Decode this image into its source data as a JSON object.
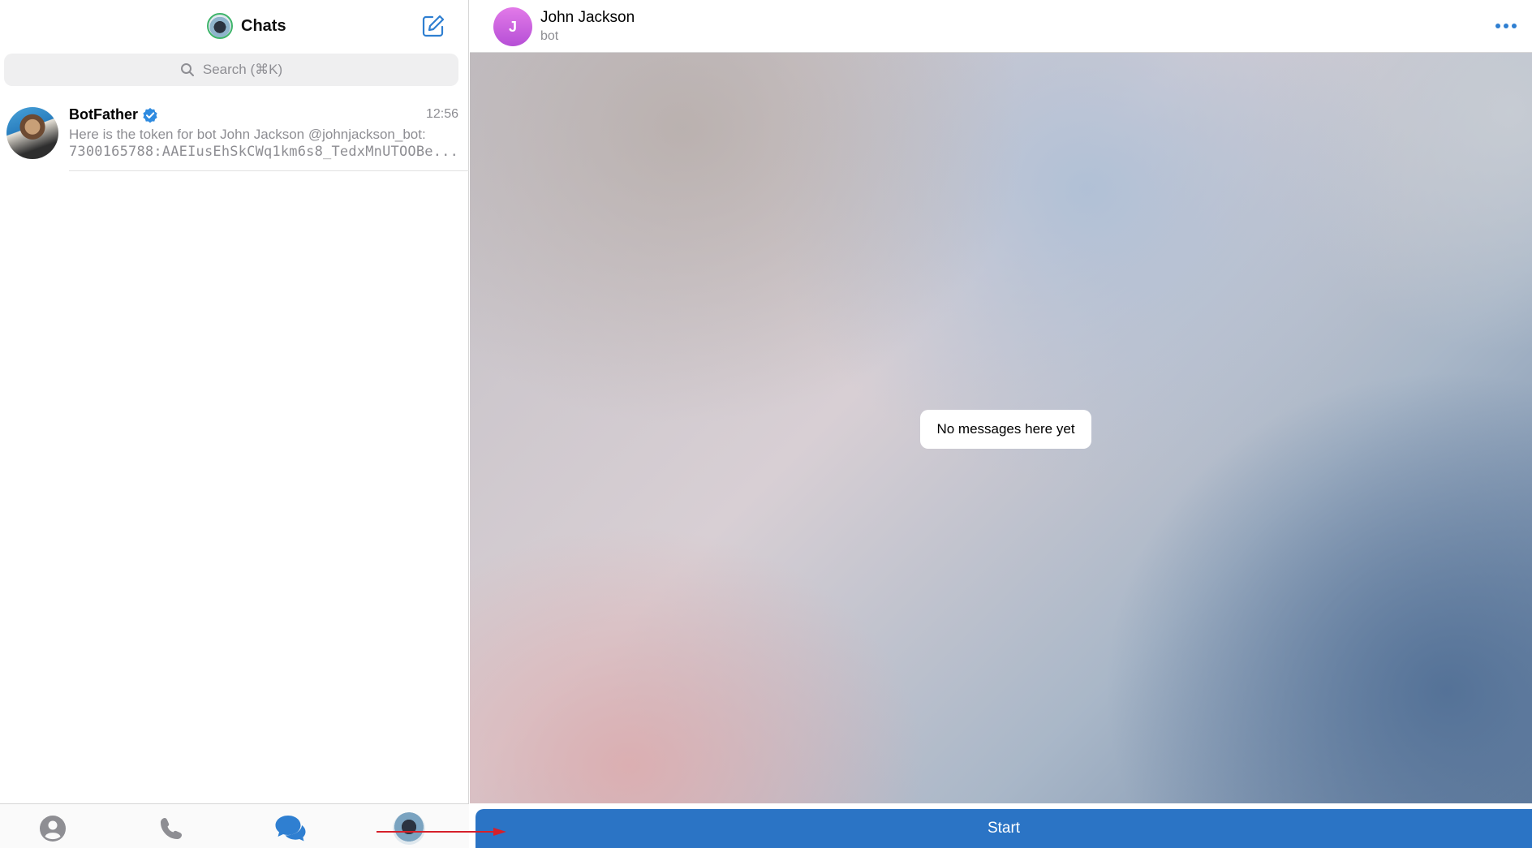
{
  "sidebar": {
    "title": "Chats",
    "search_placeholder": "Search (⌘K)",
    "chats": [
      {
        "name": "BotFather",
        "verified": true,
        "time": "12:56",
        "preview_line1": "Here is the token for bot John Jackson @johnjackson_bot:",
        "preview_line2": "7300165788:AAEIusEhSkCWq1km6s8_TedxMnUTOOBe..."
      }
    ],
    "tabs": [
      "contacts-icon",
      "calls-icon",
      "chats-icon",
      "profile-avatar"
    ]
  },
  "conversation": {
    "peer_initial": "J",
    "peer_name": "John Jackson",
    "peer_status": "bot",
    "empty_text": "No messages here yet",
    "start_label": "Start"
  },
  "colors": {
    "accent": "#2b74c5",
    "avatar_gradient": "#d269e2",
    "annotation_arrow": "#d6202a"
  }
}
